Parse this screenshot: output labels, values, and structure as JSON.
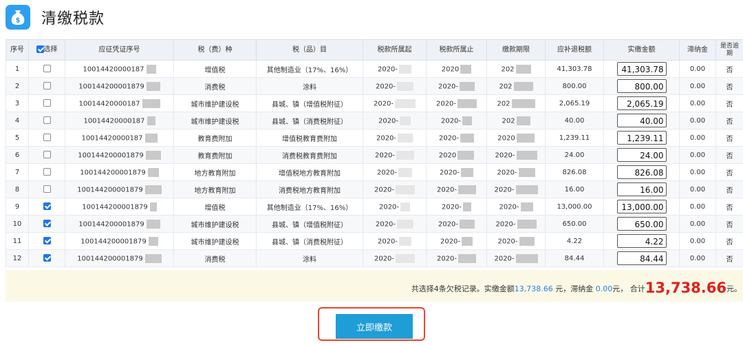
{
  "header": {
    "title": "清缴税款",
    "icon": "money-bag-icon",
    "icon_color": "#2f9ff2"
  },
  "table": {
    "columns": [
      "序号",
      "选择",
      "应征凭证序号",
      "税（费）种",
      "税（品）目",
      "税款所属起",
      "税款所属止",
      "缴款期限",
      "应补退税额",
      "实缴金额",
      "滞纳金",
      "是否逾期"
    ],
    "select_all_checked": true,
    "rows": [
      {
        "seq": "1",
        "checked": false,
        "voucher": "10014420000187",
        "tax_type": "增值税",
        "item": "其他制造业（17%、16%）",
        "start": "2020-",
        "end": "2020",
        "deadline": "202",
        "due": "41,303.78",
        "paid": "41,303.78",
        "late_fee": "0.00",
        "overdue": "否"
      },
      {
        "seq": "2",
        "checked": false,
        "voucher": "100144200001879",
        "tax_type": "消费税",
        "item": "涂料",
        "start": "2020-",
        "end": "2020-",
        "deadline": "202",
        "due": "800.00",
        "paid": "800.00",
        "late_fee": "0.00",
        "overdue": "否"
      },
      {
        "seq": "3",
        "checked": false,
        "voucher": "10014420000187",
        "tax_type": "城市维护建设税",
        "item": "县城、镇（增值税附征）",
        "start": "2020-",
        "end": "2020-",
        "deadline": "202",
        "due": "2,065.19",
        "paid": "2,065.19",
        "late_fee": "0.00",
        "overdue": "否"
      },
      {
        "seq": "4",
        "checked": false,
        "voucher": "10014420000187",
        "tax_type": "城市维护建设税",
        "item": "县城、镇（消费税附征）",
        "start": "2020-",
        "end": "2020-",
        "deadline": "202",
        "due": "40.00",
        "paid": "40.00",
        "late_fee": "0.00",
        "overdue": "否"
      },
      {
        "seq": "5",
        "checked": false,
        "voucher": "10014420000187",
        "tax_type": "教育费附加",
        "item": "增值税教育费附加",
        "start": "2020-",
        "end": "2020-",
        "deadline": "2020",
        "due": "1,239.11",
        "paid": "1,239.11",
        "late_fee": "0.00",
        "overdue": "否"
      },
      {
        "seq": "6",
        "checked": false,
        "voucher": "100144200001879",
        "tax_type": "教育费附加",
        "item": "消费税教育费附加",
        "start": "2020-",
        "end": "2020",
        "deadline": "2020-",
        "due": "24.00",
        "paid": "24.00",
        "late_fee": "0.00",
        "overdue": "否"
      },
      {
        "seq": "7",
        "checked": false,
        "voucher": "100144200001879",
        "tax_type": "地方教育附加",
        "item": "增值税地方教育附加",
        "start": "2020-",
        "end": "2020-",
        "deadline": "2020-",
        "due": "826.08",
        "paid": "826.08",
        "late_fee": "0.00",
        "overdue": "否"
      },
      {
        "seq": "8",
        "checked": false,
        "voucher": "100144200001879",
        "tax_type": "地方教育附加",
        "item": "消费税地方教育附加",
        "start": "2020-",
        "end": "2020-",
        "deadline": "2020-",
        "due": "16.00",
        "paid": "16.00",
        "late_fee": "0.00",
        "overdue": "否"
      },
      {
        "seq": "9",
        "checked": true,
        "voucher": "100144200001879",
        "tax_type": "增值税",
        "item": "其他制造业（17%、16%）",
        "start": "2020-",
        "end": "2020-",
        "deadline": "2020-",
        "due": "13,000.00",
        "paid": "13,000.00",
        "late_fee": "0.00",
        "overdue": "否"
      },
      {
        "seq": "10",
        "checked": true,
        "voucher": "100144200001879",
        "tax_type": "城市维护建设税",
        "item": "县城、镇（增值税附征）",
        "start": "2020-",
        "end": "2020-",
        "deadline": "2020-",
        "due": "650.00",
        "paid": "650.00",
        "late_fee": "0.00",
        "overdue": "否"
      },
      {
        "seq": "11",
        "checked": true,
        "voucher": "100144200001879",
        "tax_type": "城市维护建设税",
        "item": "县城、镇（消费税附征）",
        "start": "2020-",
        "end": "2020-",
        "deadline": "2020-",
        "due": "4.22",
        "paid": "4.22",
        "late_fee": "0.00",
        "overdue": "否"
      },
      {
        "seq": "12",
        "checked": true,
        "voucher": "100144200001879",
        "tax_type": "消费税",
        "item": "涂料",
        "start": "2020-",
        "end": "2020-",
        "deadline": "2020-",
        "due": "84.44",
        "paid": "84.44",
        "late_fee": "0.00",
        "overdue": "否"
      }
    ]
  },
  "summary": {
    "part1": "共选择4条欠税记录。实缴金额",
    "paid_amount": "13,738.66",
    "part2": " 元，滞纳金 ",
    "late_fee": "0.00",
    "part3": "元， 合计",
    "total": "13,738.66",
    "part4": "元。"
  },
  "actions": {
    "pay_now_label": "立即缴款",
    "button_color": "#1f9dd6",
    "highlight_color": "#e8442b"
  }
}
